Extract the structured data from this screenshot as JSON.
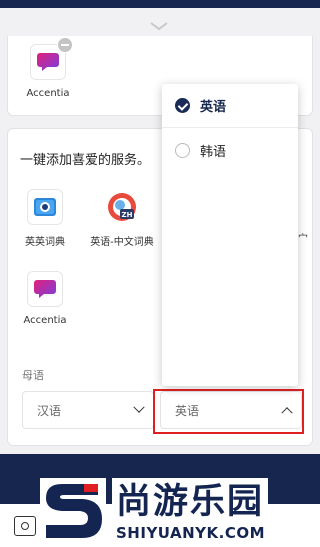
{
  "top_card": {
    "app": {
      "label": "Accentia",
      "icon": "accentia-chat-icon"
    }
  },
  "services": {
    "title": "一键添加喜爱的服务。",
    "apps": [
      {
        "label": "英英词典",
        "icon": "dictionary-camera-icon"
      },
      {
        "label": "英语-中文词典",
        "icon": "zh-dictionary-icon"
      },
      {
        "label": "Accentia",
        "icon": "accentia-chat-icon"
      }
    ],
    "peek_text": "宀"
  },
  "native_language": {
    "label": "母语",
    "left_select": "汉语",
    "right_select": "英语"
  },
  "dropdown": {
    "options": [
      {
        "label": "英语",
        "selected": true
      },
      {
        "label": "韩语",
        "selected": false
      }
    ]
  },
  "watermark": {
    "text": "尚游乐园",
    "sub": "SHIYUANYK.COM",
    "colors": {
      "brand": "#142551",
      "highlight": "#e02020"
    }
  }
}
